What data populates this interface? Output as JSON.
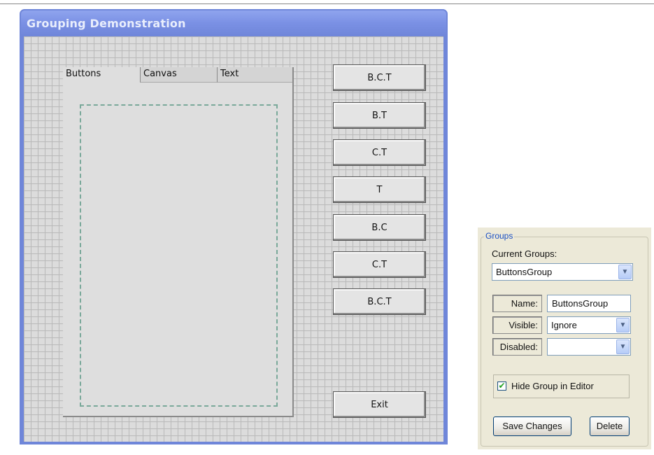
{
  "window": {
    "title": "Grouping Demonstration"
  },
  "tabs": [
    {
      "label": "Buttons",
      "active": true
    },
    {
      "label": "Canvas",
      "active": false
    },
    {
      "label": "Text",
      "active": false
    }
  ],
  "buttons": [
    {
      "label": "B.C.T"
    },
    {
      "label": "B.T"
    },
    {
      "label": "C.T"
    },
    {
      "label": "T"
    },
    {
      "label": "B.C"
    },
    {
      "label": "C.T"
    },
    {
      "label": "B.C.T"
    }
  ],
  "exit_button": {
    "label": "Exit"
  },
  "groups_panel": {
    "legend": "Groups",
    "current_groups_label": "Current Groups:",
    "current_groups_value": "ButtonsGroup",
    "name_label": "Name:",
    "name_value": "ButtonsGroup",
    "visible_label": "Visible:",
    "visible_value": "Ignore",
    "disabled_label": "Disabled:",
    "disabled_value": "",
    "hide_group_label": "Hide Group in Editor",
    "hide_group_checked": true,
    "save_label": "Save Changes",
    "delete_label": "Delete"
  },
  "colors": {
    "titlebar": "#6f86d9",
    "legend_text": "#1a4fc4",
    "dashed_border": "#7aa99a"
  }
}
